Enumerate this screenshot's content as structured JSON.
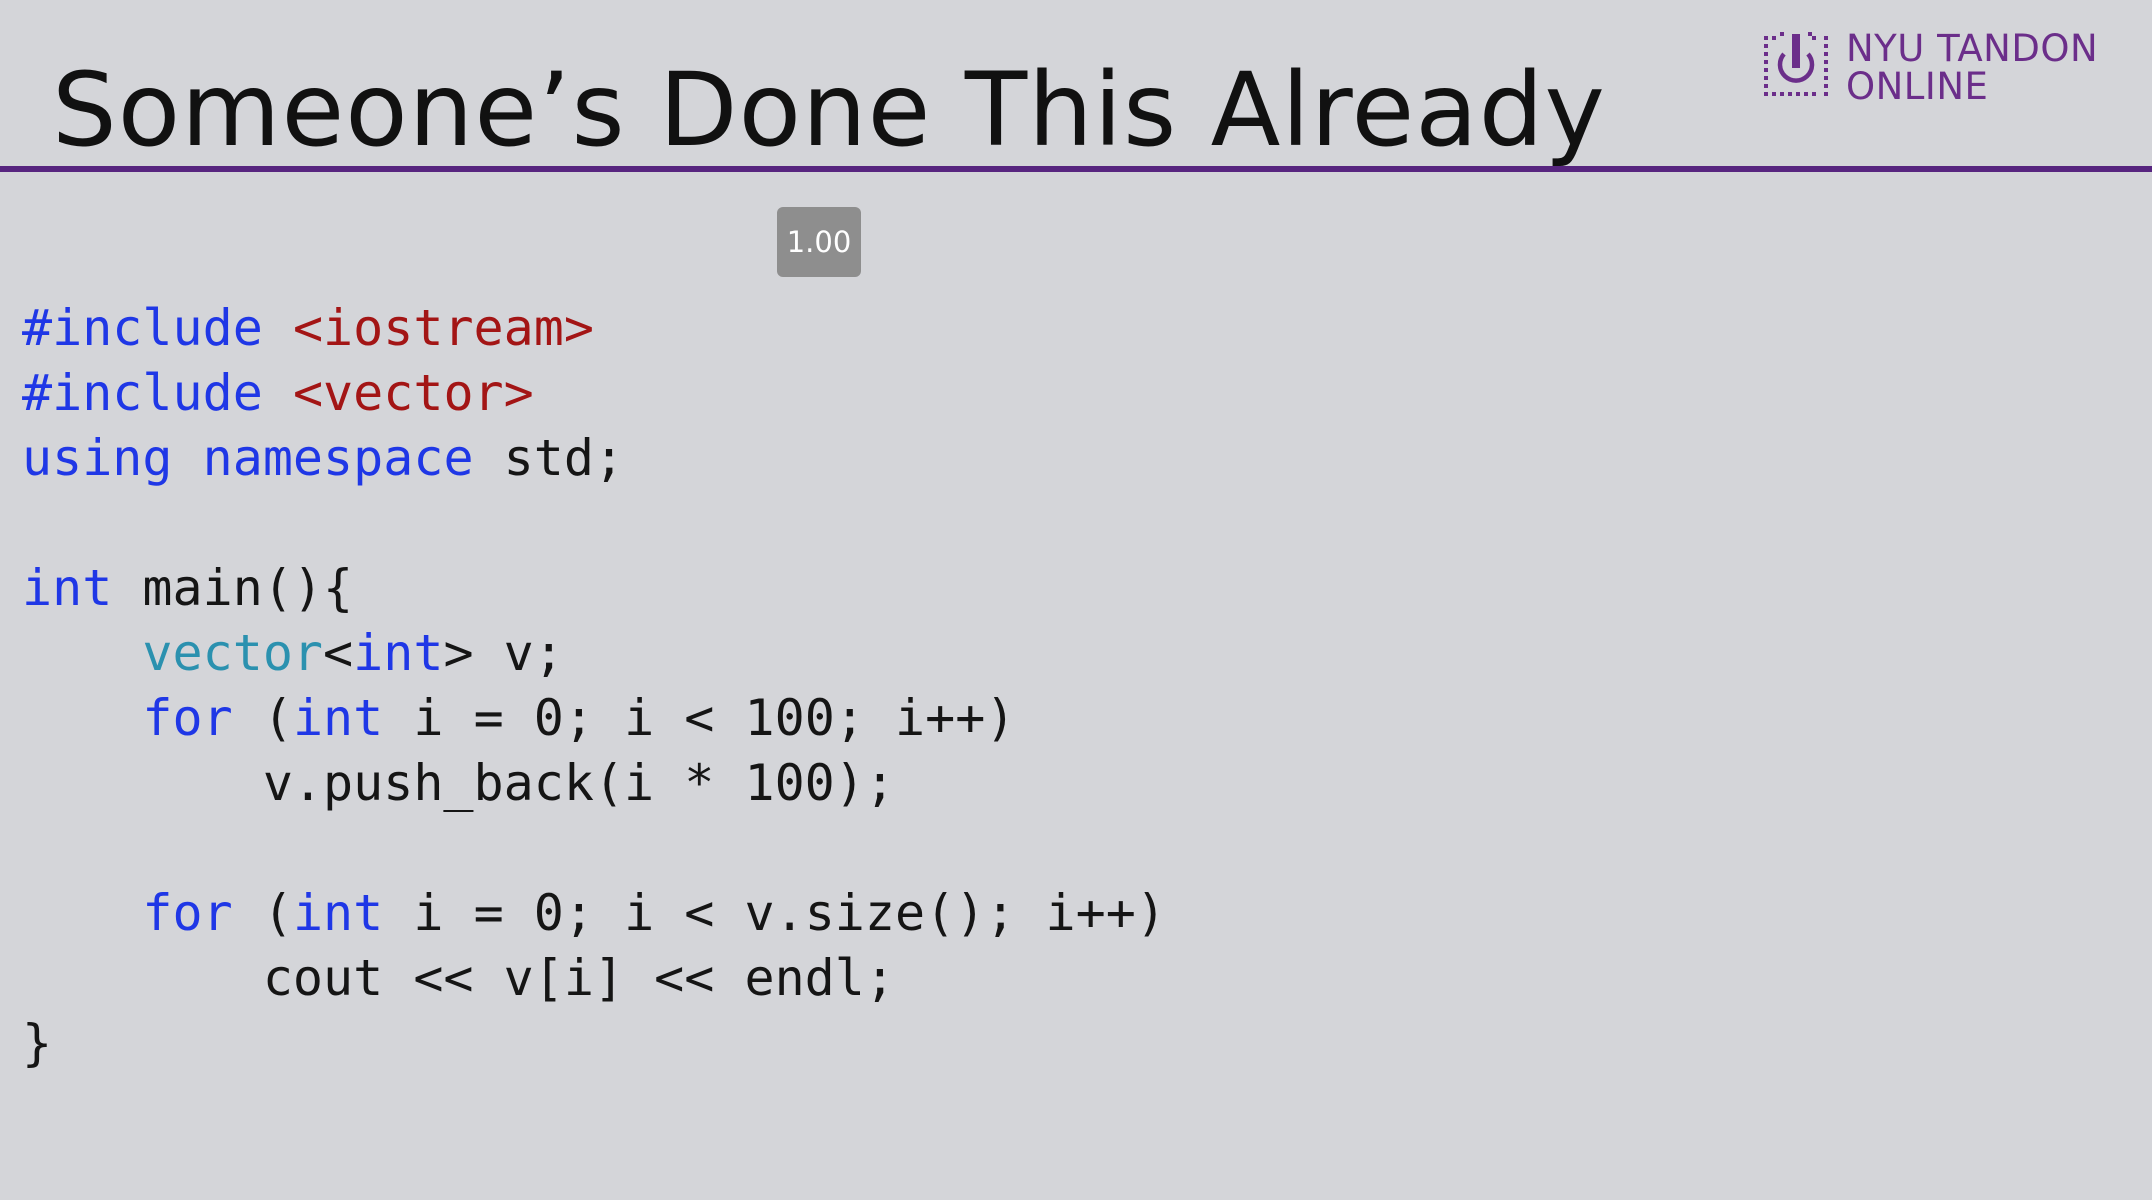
{
  "slide": {
    "title": "Someone’s Done This Already"
  },
  "logo": {
    "line1": "NYU TANDON",
    "line2": "ONLINE",
    "accent_color": "#6b2e8a",
    "icon": "nyu-torch-icon"
  },
  "colors": {
    "background": "#d4d5d9",
    "rule": "#57257f",
    "keyword": "#1f37e6",
    "string": "#a31515",
    "type": "#2b91af"
  },
  "zoom_badge": {
    "value": "1.00"
  },
  "code": {
    "language": "C++",
    "lines": [
      [
        {
          "t": "#include",
          "c": "kw"
        },
        {
          "t": " "
        },
        {
          "t": "<iostream>",
          "c": "str"
        }
      ],
      [
        {
          "t": "#include",
          "c": "kw"
        },
        {
          "t": " "
        },
        {
          "t": "<vector>",
          "c": "str"
        }
      ],
      [
        {
          "t": "using",
          "c": "kw"
        },
        {
          "t": " "
        },
        {
          "t": "namespace",
          "c": "kw"
        },
        {
          "t": " std;"
        }
      ],
      [],
      [
        {
          "t": "int",
          "c": "kw"
        },
        {
          "t": " main(){"
        }
      ],
      [
        {
          "t": "    "
        },
        {
          "t": "vector",
          "c": "type"
        },
        {
          "t": "<"
        },
        {
          "t": "int",
          "c": "kw"
        },
        {
          "t": "> v;"
        }
      ],
      [
        {
          "t": "    "
        },
        {
          "t": "for",
          "c": "kw"
        },
        {
          "t": " ("
        },
        {
          "t": "int",
          "c": "kw"
        },
        {
          "t": " i = 0; i < 100; i++)"
        }
      ],
      [
        {
          "t": "        v.push_back(i * 100);"
        }
      ],
      [],
      [
        {
          "t": "    "
        },
        {
          "t": "for",
          "c": "kw"
        },
        {
          "t": " ("
        },
        {
          "t": "int",
          "c": "kw"
        },
        {
          "t": " i = 0; i < v.size(); i++)"
        }
      ],
      [
        {
          "t": "        cout << v[i] << endl;"
        }
      ],
      [
        {
          "t": "}"
        }
      ]
    ]
  }
}
